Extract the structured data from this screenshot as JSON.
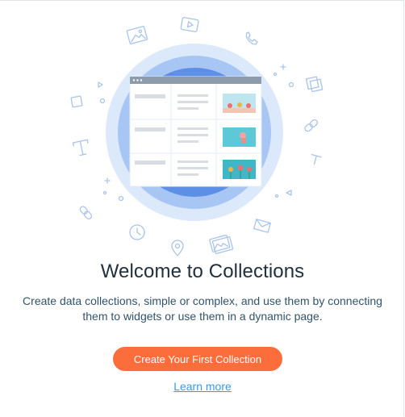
{
  "empty_state": {
    "title": "Welcome to Collections",
    "description_line1": "Create data collections, simple or complex, and use them by connecting",
    "description_line2": "them to widgets or use them in a dynamic page.",
    "cta_label": "Create Your First Collection",
    "learn_more_label": "Learn more"
  },
  "colors": {
    "accent_blue": "#3899ec",
    "cta_orange": "#fb6e3b",
    "title_text": "#20303c",
    "body_text": "#32536a",
    "circle_outer": "#dbe9fb",
    "circle_middle": "#a8c6f4",
    "circle_inner": "#5d8fe6",
    "icon_stroke": "#a9c4ea"
  },
  "icons": [
    "image-icon",
    "video-icon",
    "phone-icon",
    "layers-icon",
    "link-icon",
    "text-icon",
    "email-icon",
    "location-icon",
    "clock-icon",
    "gallery-icon",
    "table-icon"
  ]
}
